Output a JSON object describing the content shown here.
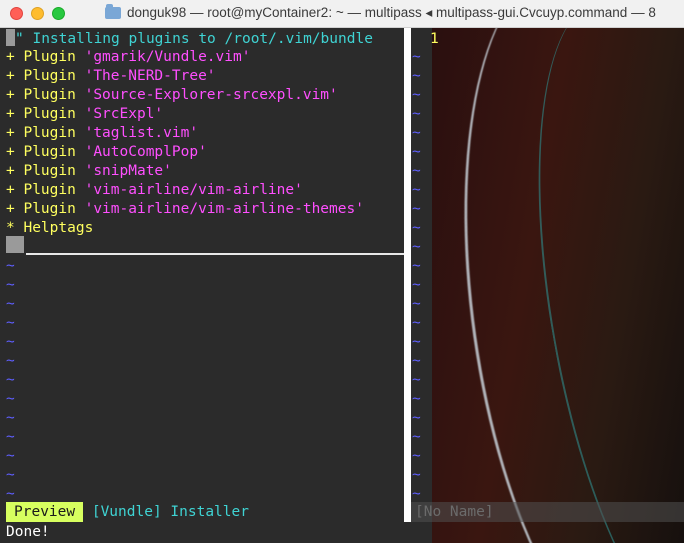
{
  "window": {
    "title": "donguk98 — root@myContainer2: ~ — multipass ◂ multipass-gui.Cvcuyp.command — 8"
  },
  "left_pane": {
    "header_text": "\" Installing plugins to /root/.vim/bundle",
    "plugins": [
      {
        "prefix": "+",
        "keyword": "Plugin",
        "name": "'gmarik/Vundle.vim'"
      },
      {
        "prefix": "+",
        "keyword": "Plugin",
        "name": "'The-NERD-Tree'"
      },
      {
        "prefix": "+",
        "keyword": "Plugin",
        "name": "'Source-Explorer-srcexpl.vim'"
      },
      {
        "prefix": "+",
        "keyword": "Plugin",
        "name": "'SrcExpl'"
      },
      {
        "prefix": "+",
        "keyword": "Plugin",
        "name": "'taglist.vim'"
      },
      {
        "prefix": "+",
        "keyword": "Plugin",
        "name": "'AutoComplPop'"
      },
      {
        "prefix": "+",
        "keyword": "Plugin",
        "name": "'snipMate'"
      },
      {
        "prefix": "+",
        "keyword": "Plugin",
        "name": "'vim-airline/vim-airline'"
      },
      {
        "prefix": "+",
        "keyword": "Plugin",
        "name": "'vim-airline/vim-airline-themes'"
      }
    ],
    "helptags": {
      "prefix": "*",
      "label": "Helptags"
    },
    "tilde": "~"
  },
  "right_pane": {
    "line_number": "1",
    "tilde": "~"
  },
  "statusline": {
    "mode_badge": "Preview",
    "title": "[Vundle] Installer",
    "right_buffer": "[No Name]"
  },
  "message": "Done!",
  "colors": {
    "plugin_name": "#ff4fff",
    "keyword": "#ffff5f",
    "header": "#3fd3d3",
    "tilde": "#5f5fff",
    "badge_bg": "#d7ff5f"
  }
}
